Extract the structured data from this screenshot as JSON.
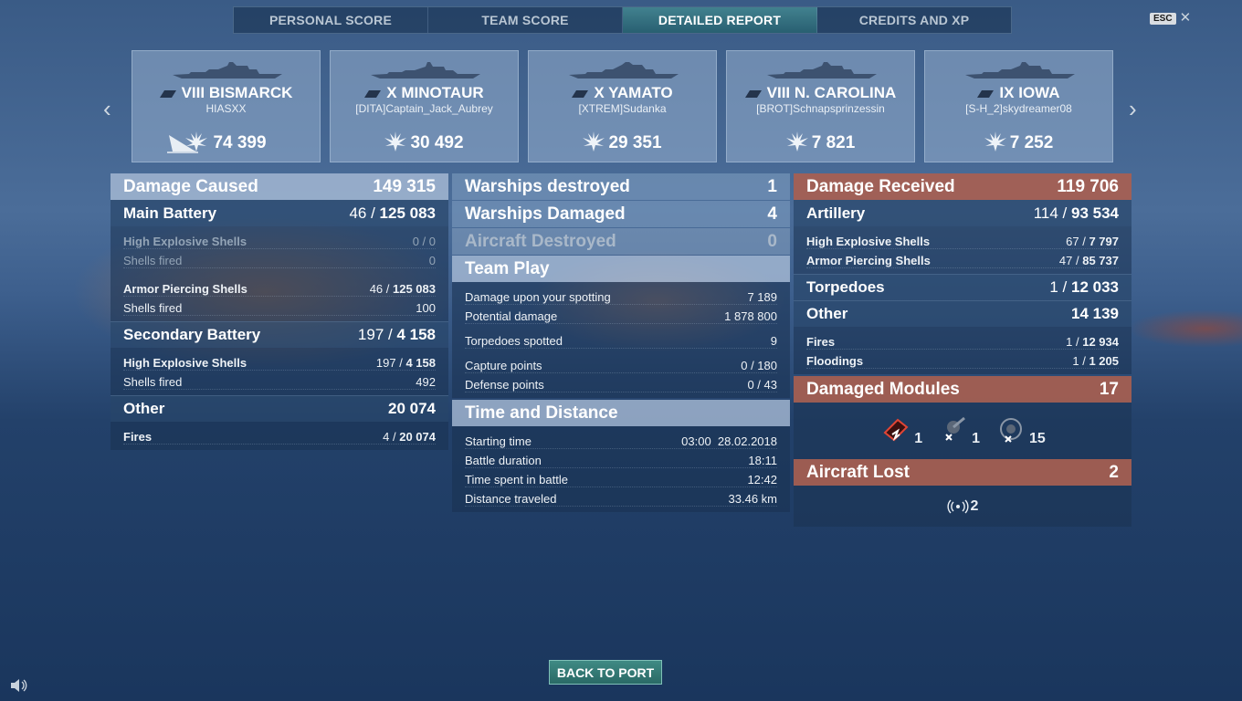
{
  "tabs": [
    "PERSONAL SCORE",
    "TEAM SCORE",
    "DETAILED REPORT",
    "CREDITS AND XP"
  ],
  "active_tab": "DETAILED REPORT",
  "esc_label": "ESC",
  "close_glyph": "✕",
  "nav": {
    "prev": "‹",
    "next": "›"
  },
  "ships": [
    {
      "tier": "VIII",
      "name": "BISMARCK",
      "player": "HIASXX",
      "damage": "74 399",
      "sunk_icon": true
    },
    {
      "tier": "X",
      "name": "MINOTAUR",
      "player": "[DITA]Captain_Jack_Aubrey",
      "damage": "30 492"
    },
    {
      "tier": "X",
      "name": "YAMATO",
      "player": "[XTREM]Sudanka",
      "damage": "29 351"
    },
    {
      "tier": "VIII",
      "name": "N. CAROLINA",
      "player": "[BROT]Schnapsprinzessin",
      "damage": "7 821"
    },
    {
      "tier": "IX",
      "name": "IOWA",
      "player": "[S-H_2]skydreamer08",
      "damage": "7 252"
    }
  ],
  "caused": {
    "title": "Damage Caused",
    "total": "149 315",
    "main": {
      "title": "Main Battery",
      "hits": "46 /",
      "dmg": "125 083",
      "he_label": "High Explosive Shells",
      "he_val": "0 / 0",
      "he_fired_label": "Shells fired",
      "he_fired": "0",
      "ap_label": "Armor Piercing Shells",
      "ap_hits": "46 /",
      "ap_dmg": "125 083",
      "ap_fired_label": "Shells fired",
      "ap_fired": "100"
    },
    "secondary": {
      "title": "Secondary Battery",
      "hits": "197 /",
      "dmg": "4 158",
      "he_label": "High Explosive Shells",
      "he_hits": "197 /",
      "he_dmg": "4 158",
      "fired_label": "Shells fired",
      "fired": "492"
    },
    "other": {
      "title": "Other",
      "total": "20 074",
      "fires_label": "Fires",
      "fires_hits": "4 /",
      "fires_dmg": "20 074"
    }
  },
  "middle": {
    "destroyed_label": "Warships destroyed",
    "destroyed": "1",
    "damaged_label": "Warships Damaged",
    "damaged": "4",
    "aircraft_label": "Aircraft Destroyed",
    "aircraft": "0",
    "team_title": "Team Play",
    "spot_label": "Damage upon your spotting",
    "spot": "7 189",
    "potential_label": "Potential damage",
    "potential": "1 878 800",
    "torp_label": "Torpedoes spotted",
    "torp": "9",
    "capture_label": "Capture points",
    "capture": "0 / 180",
    "defense_label": "Defense points",
    "defense": "0 / 43",
    "time_title": "Time and Distance",
    "start_label": "Starting time",
    "start": "03:00  28.02.2018",
    "duration_label": "Battle duration",
    "duration": "18:11",
    "spent_label": "Time spent in battle",
    "spent": "12:42",
    "distance_label": "Distance traveled",
    "distance": "33.46 km"
  },
  "received": {
    "title": "Damage Received",
    "total": "119 706",
    "artillery": {
      "title": "Artillery",
      "hits": "114 /",
      "dmg": "93 534",
      "he_label": "High Explosive Shells",
      "he_hits": "67 /",
      "he_dmg": "7 797",
      "ap_label": "Armor Piercing Shells",
      "ap_hits": "47 /",
      "ap_dmg": "85 737"
    },
    "torpedoes": {
      "title": "Torpedoes",
      "hits": "1 /",
      "dmg": "12 033"
    },
    "other": {
      "title": "Other",
      "total": "14 139",
      "fires_label": "Fires",
      "fires_hits": "1 /",
      "fires_dmg": "12 934",
      "flood_label": "Floodings",
      "flood_hits": "1 /",
      "flood_dmg": "1 205"
    },
    "modules": {
      "title": "Damaged Modules",
      "total": "17",
      "a": "1",
      "b": "1",
      "c": "15"
    },
    "aircraft": {
      "title": "Aircraft Lost",
      "total": "2",
      "squadrons": "2"
    }
  },
  "back_label": "BACK TO PORT"
}
